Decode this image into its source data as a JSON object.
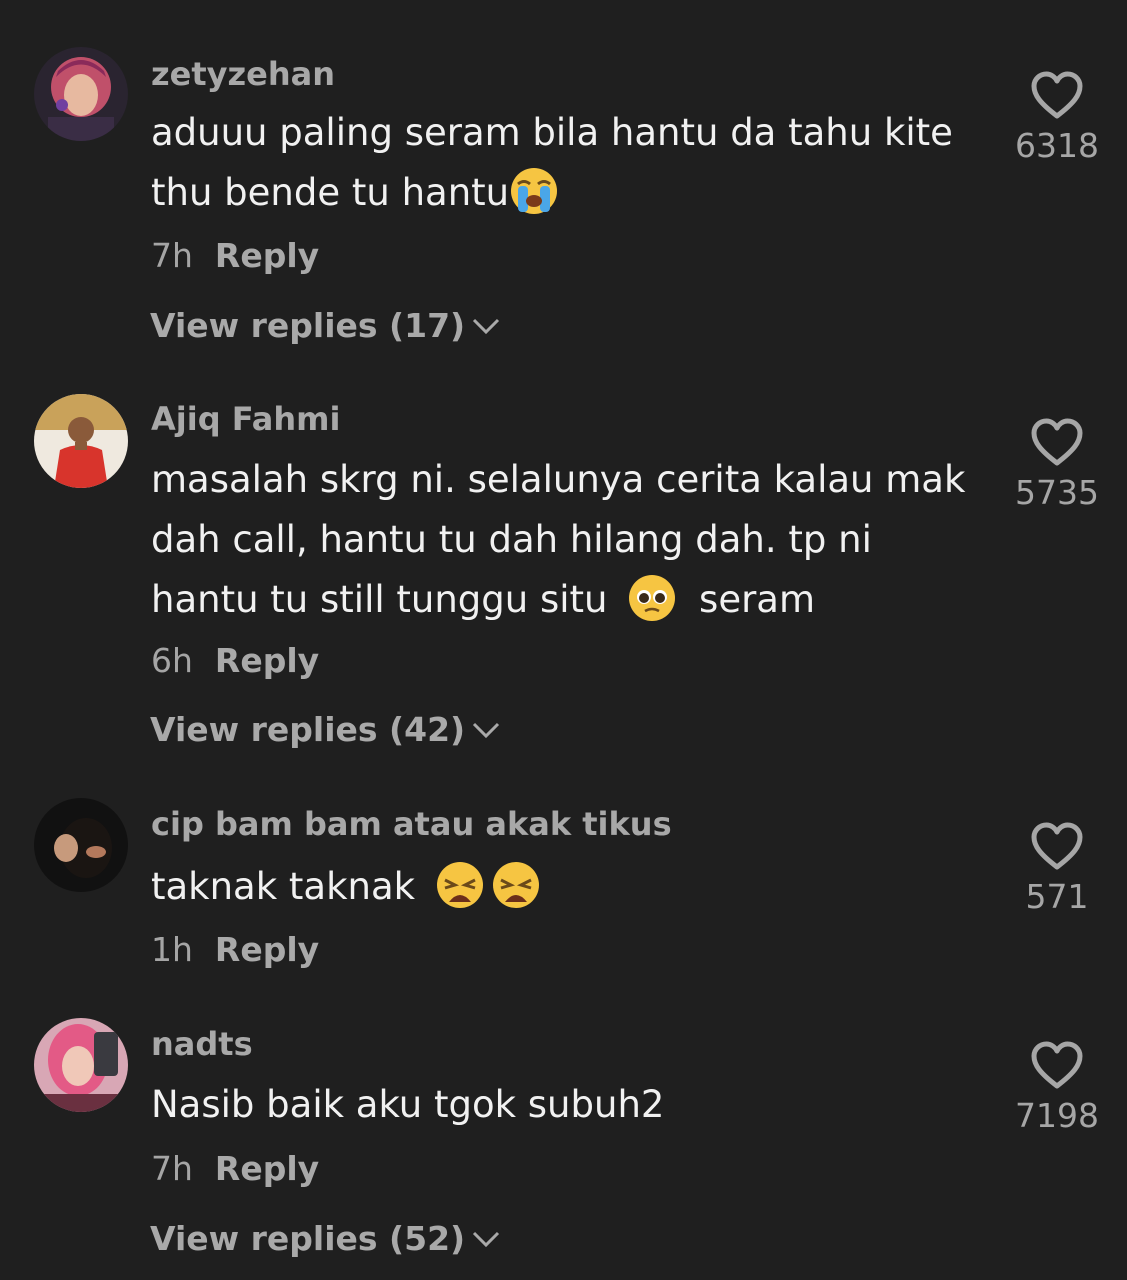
{
  "colors": {
    "background": "#1f1f1f",
    "username": "#a8a8a8",
    "comment_text": "#f1f1f1",
    "secondary_text": "#a5a5a5"
  },
  "comments": [
    {
      "username": "zetyzehan",
      "text_lines": [
        "aduuu paling seram bila hantu da tahu kite",
        "thu bende tu hantu"
      ],
      "emojis": [
        "loudly-crying-face"
      ],
      "time": "7h",
      "reply_label": "Reply",
      "view_replies": "View replies (17)",
      "likes": "6318"
    },
    {
      "username": "Ajiq Fahmi",
      "text_lines": [
        "masalah skrg ni. selalunya cerita kalau mak",
        "dah call, hantu tu dah hilang dah. tp ni",
        "hantu tu still tunggu situ",
        "seram"
      ],
      "emojis": [
        "pleading-face"
      ],
      "time": "6h",
      "reply_label": "Reply",
      "view_replies": "View replies (42)",
      "likes": "5735"
    },
    {
      "username": "cip bam bam atau akak tikus",
      "text_lines": [
        "taknak taknak"
      ],
      "emojis": [
        "weary-face",
        "weary-face"
      ],
      "time": "1h",
      "reply_label": "Reply",
      "likes": "571"
    },
    {
      "username": "nadts",
      "text_lines": [
        "Nasib baik aku tgok subuh2"
      ],
      "time": "7h",
      "reply_label": "Reply",
      "view_replies": "View replies (52)",
      "likes": "7198"
    }
  ],
  "icons": {
    "like": "heart-outline-icon",
    "expand": "chevron-down-icon"
  }
}
